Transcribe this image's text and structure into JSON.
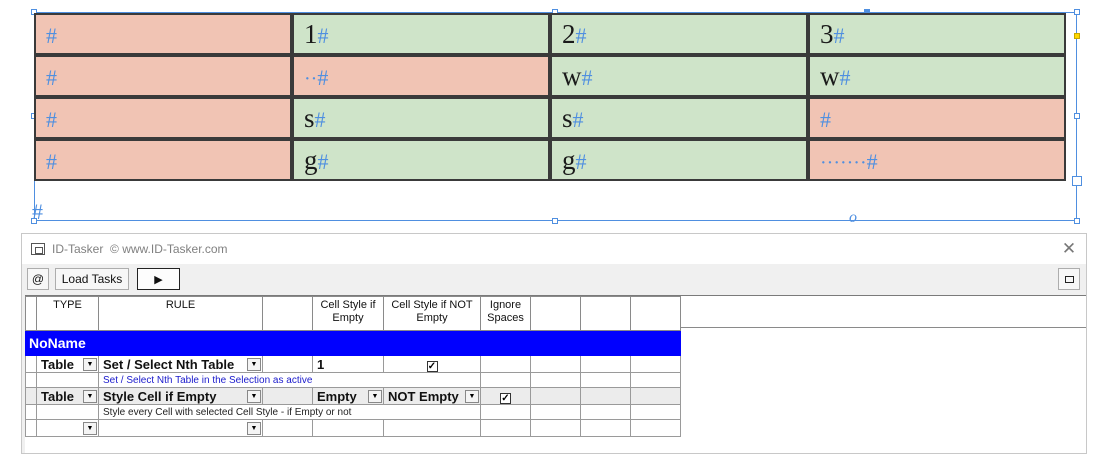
{
  "document": {
    "table": [
      [
        {
          "text": "",
          "marker": "#",
          "state": "empty"
        },
        {
          "text": "1",
          "marker": "#",
          "state": "filled"
        },
        {
          "text": "2",
          "marker": "#",
          "state": "filled"
        },
        {
          "text": "3",
          "marker": "#",
          "state": "filled"
        }
      ],
      [
        {
          "text": "",
          "marker": "#",
          "state": "empty"
        },
        {
          "text": "··",
          "marker": "#",
          "state": "empty"
        },
        {
          "text": "w",
          "marker": "#",
          "state": "filled"
        },
        {
          "text": "w",
          "marker": "#",
          "state": "filled"
        }
      ],
      [
        {
          "text": "",
          "marker": "#",
          "state": "empty"
        },
        {
          "text": "s",
          "marker": "#",
          "state": "filled"
        },
        {
          "text": "s",
          "marker": "#",
          "state": "filled"
        },
        {
          "text": "",
          "marker": "#",
          "state": "empty"
        }
      ],
      [
        {
          "text": "",
          "marker": "#",
          "state": "empty"
        },
        {
          "text": "g",
          "marker": "#",
          "state": "filled"
        },
        {
          "text": "g",
          "marker": "#",
          "state": "filled"
        },
        {
          "text": "·······",
          "marker": "#",
          "state": "empty"
        }
      ]
    ],
    "after_table_marker": "#",
    "overset_marker": "o",
    "colors": {
      "empty_cell": "#f1c4b4",
      "filled_cell": "#cfe4c9",
      "frame": "#4f8fe0"
    }
  },
  "window": {
    "title": "ID-Tasker",
    "subtitle": "© www.ID-Tasker.com",
    "close_label": "✕",
    "toolbar": {
      "at_label": "@",
      "load_tasks_label": "Load Tasks",
      "run_label": "▶",
      "restore_label": "🗗"
    },
    "columns": {
      "type": "TYPE",
      "rule": "RULE",
      "blank": "",
      "cs_empty": "Cell Style if Empty",
      "cs_not_empty": "Cell Style if NOT Empty",
      "ignore_spaces": "Ignore Spaces"
    },
    "group_name": "NoName",
    "rows": [
      {
        "type": "Table",
        "rule": "Set / Select Nth Table",
        "value": "1",
        "checkbox_in_cs_not_empty": true,
        "description": "Set / Select Nth Table in the Selection as active"
      },
      {
        "type": "Table",
        "rule": "Style Cell if Empty",
        "cs_empty": "Empty",
        "cs_not_empty": "NOT Empty",
        "ignore_spaces_checked": true,
        "description": "Style every Cell with selected Cell Style - if Empty or not"
      }
    ],
    "checkbox_glyph": "✓",
    "dropdown_glyph": "▼",
    "group_color": "#0000ff"
  }
}
